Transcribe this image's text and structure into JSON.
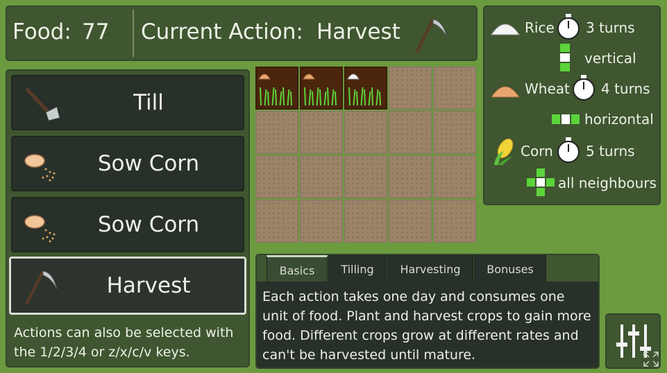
{
  "status": {
    "food_label": "Food:",
    "food_value": "77",
    "action_label": "Current Action:",
    "action_value": "Harvest"
  },
  "actions": [
    {
      "label": "Till",
      "icon": "hoe-icon"
    },
    {
      "label": "Sow Corn",
      "icon": "sow-seeds-icon"
    },
    {
      "label": "Sow Corn",
      "icon": "sow-seeds-icon"
    },
    {
      "label": "Harvest",
      "icon": "scythe-icon",
      "selected": true
    }
  ],
  "actions_hint": "Actions can also be selected with the 1/2/3/4 or z/x/c/v keys.",
  "legend": [
    {
      "crop": "Rice",
      "turns": "3 turns",
      "pattern": "vertical",
      "icon": "rice-icon"
    },
    {
      "crop": "Wheat",
      "turns": "4 turns",
      "pattern": "horizontal",
      "icon": "wheat-icon"
    },
    {
      "crop": "Corn",
      "turns": "5 turns",
      "pattern": "all neighbours",
      "icon": "corn-icon"
    }
  ],
  "grid": {
    "rows": 4,
    "cols": 5,
    "tilled_cells": [
      {
        "row": 0,
        "col": 0,
        "crop": "wheat"
      },
      {
        "row": 0,
        "col": 1,
        "crop": "wheat"
      },
      {
        "row": 0,
        "col": 2,
        "crop": "rice"
      }
    ]
  },
  "tabs": [
    "Basics",
    "Tilling",
    "Harvesting",
    "Bonuses"
  ],
  "active_tab": "Basics",
  "help_text": "Each action takes one day and consumes one unit of food. Plant and harvest crops to gain more food. Different crops grow at different rates and can't be harvested until mature.",
  "colors": {
    "background": "#6b9a3f",
    "panel": "#3f5630",
    "button": "#28302a",
    "tilled": "#4b250c",
    "soil": "#9c8468",
    "sprout": "#5bd43b"
  }
}
